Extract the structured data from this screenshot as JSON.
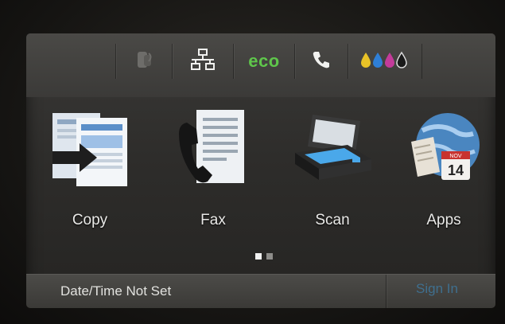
{
  "status_bar": {
    "items": [
      {
        "icon": "wireless-direct-icon"
      },
      {
        "icon": "network-icon"
      },
      {
        "icon": "eco-icon",
        "label": "eco"
      },
      {
        "icon": "phone-icon"
      },
      {
        "icon": "ink-levels-icon"
      }
    ]
  },
  "apps": [
    {
      "label": "Copy",
      "icon": "copy-icon"
    },
    {
      "label": "Fax",
      "icon": "fax-icon"
    },
    {
      "label": "Scan",
      "icon": "scan-icon"
    },
    {
      "label": "Apps",
      "icon": "apps-icon",
      "calendar_month": "NOV",
      "calendar_day": "14"
    }
  ],
  "pager": {
    "pages": 2,
    "current": 1
  },
  "bottom_bar": {
    "datetime": "Date/Time Not Set",
    "sign_in": "Sign In"
  },
  "colors": {
    "eco_green": "#5fc64b",
    "sign_in_blue": "#3f6f8e",
    "ink": [
      "#e8c227",
      "#2f7fd6",
      "#c33b9a",
      "#1a1a1a"
    ]
  }
}
